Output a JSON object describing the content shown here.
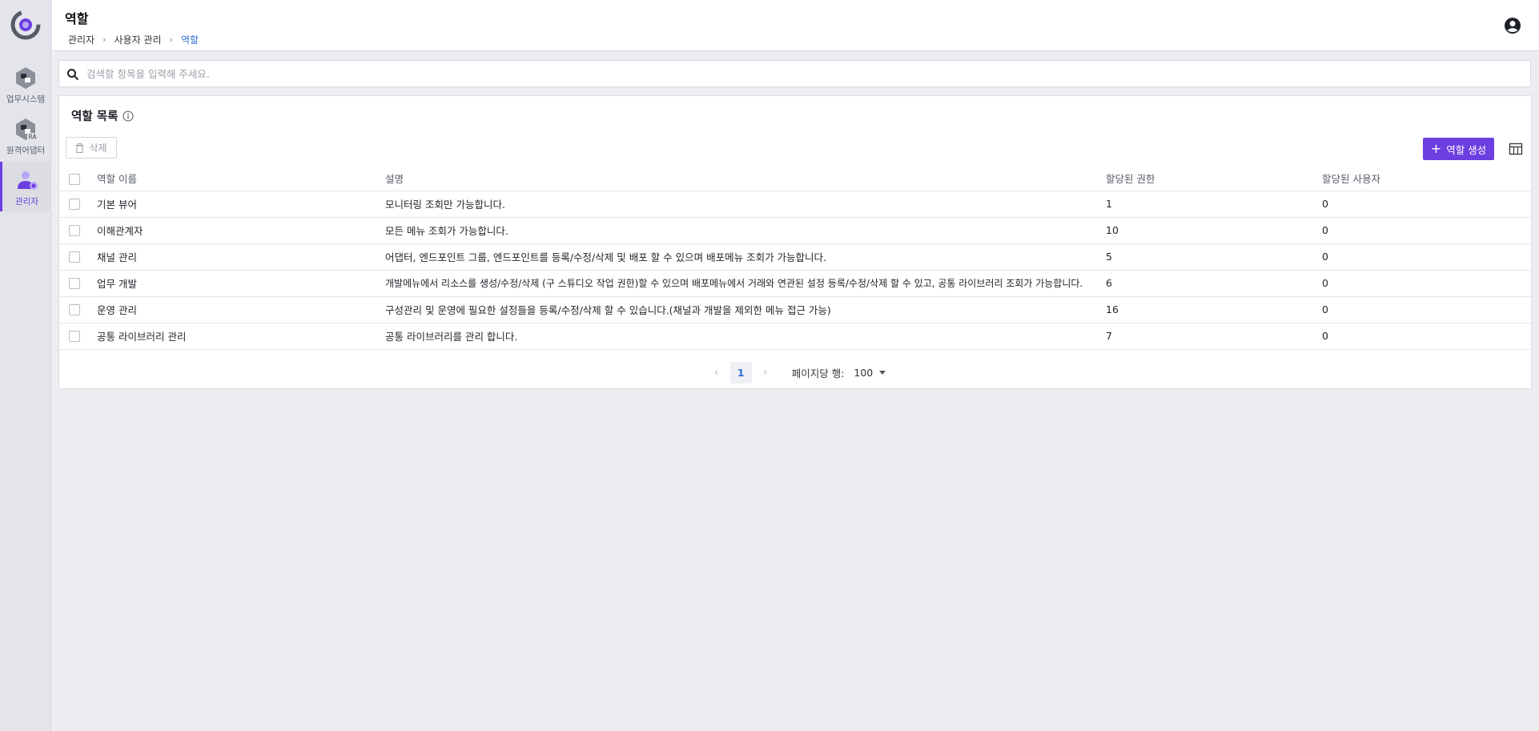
{
  "app": {
    "brand_color": "#6c3fe0",
    "link_color": "#2f6fd6"
  },
  "sidebar": {
    "items": [
      {
        "label": "업무시스템",
        "icon": "business-system-icon",
        "active": false
      },
      {
        "label": "원격어댑터",
        "icon": "remote-adapter-icon",
        "badge": "RA",
        "active": false
      },
      {
        "label": "관리자",
        "icon": "admin-user-icon",
        "active": true
      }
    ]
  },
  "header": {
    "title": "역할",
    "breadcrumb": [
      "관리자",
      "사용자 관리",
      "역할"
    ]
  },
  "search": {
    "placeholder": "검색할 항목을 입력해 주세요.",
    "value": ""
  },
  "card": {
    "title": "역할 목록",
    "delete_label": "삭제",
    "create_label": "역할 생성",
    "columns": [
      "역할 이름",
      "설명",
      "할당된 권한",
      "할당된 사용자"
    ],
    "rows": [
      {
        "name": "기본 뷰어",
        "desc": "모니터링 조회만 가능합니다.",
        "perm": "1",
        "users": "0"
      },
      {
        "name": "이해관계자",
        "desc": "모든 메뉴 조회가 가능합니다.",
        "perm": "10",
        "users": "0"
      },
      {
        "name": "채널 관리",
        "desc": "어댑터, 엔드포인트 그룹, 엔드포인트를 등록/수정/삭제 및 배포 할 수 있으며 배포메뉴 조회가 가능합니다.",
        "perm": "5",
        "users": "0"
      },
      {
        "name": "업무 개발",
        "desc": "개발메뉴에서 리소스를 생성/수정/삭제 (구 스튜디오 작업 권한)할 수 있으며 배포메뉴에서 거래와 연관된 설정 등록/수정/삭제 할 수 있고, 공통 라이브러리 조회가 가능합니다.",
        "perm": "6",
        "users": "0"
      },
      {
        "name": "운영 관리",
        "desc": "구성관리 및 운영에 필요한 설정들을 등록/수정/삭제 할 수 있습니다.(채널과 개발을 제외한 메뉴 접근 가능)",
        "perm": "16",
        "users": "0"
      },
      {
        "name": "공통 라이브러리 관리",
        "desc": "공통 라이브러리를 관리 합니다.",
        "perm": "7",
        "users": "0"
      }
    ]
  },
  "pagination": {
    "current_page": "1",
    "rows_per_page_label": "페이지당 행:",
    "rows_per_page": "100"
  }
}
